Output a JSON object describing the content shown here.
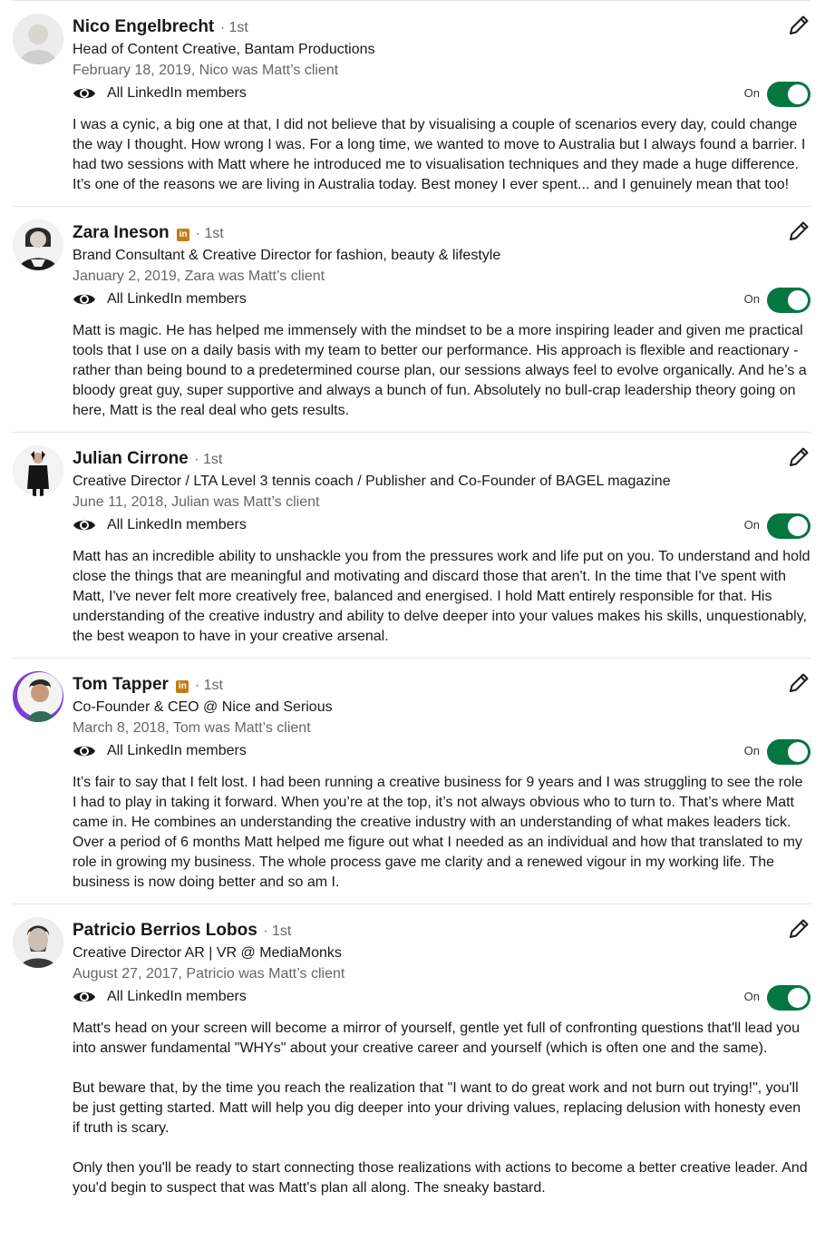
{
  "recommendations": [
    {
      "name": "Nico Engelbrecht",
      "badge": "",
      "degree": "· 1st",
      "headline": "Head of Content Creative, Bantam Productions",
      "date": "February 18, 2019, Nico was Matt’s client",
      "visibility": "All LinkedIn members",
      "toggle_label": "On",
      "text": "I was a cynic, a big one at that, I did not believe that by visualising a couple of scenarios every day, could change the way I thought. How wrong I was. For a long time, we wanted to move to Australia but I always found a barrier. I had two sessions with Matt where he introduced me to visualisation techniques and they made a huge difference. It’s one of the reasons we are living in Australia today. Best money I ever spent... and I genuinely mean that too!"
    },
    {
      "name": "Zara Ineson",
      "badge": "in",
      "degree": "· 1st",
      "headline": "Brand Consultant & Creative Director for fashion, beauty & lifestyle",
      "date": "January 2, 2019, Zara was Matt’s client",
      "visibility": "All LinkedIn members",
      "toggle_label": "On",
      "text": "Matt is magic. He has helped me immensely with the mindset to be a more inspiring leader and given me practical tools that I use on a daily basis with my team to better our performance. His approach is flexible and reactionary - rather than being bound to a predetermined course plan, our sessions always feel to evolve organically. And he’s a bloody great guy, super supportive and always a bunch of fun. Absolutely no bull-crap leadership theory going on here, Matt is the real deal who gets results."
    },
    {
      "name": "Julian Cirrone",
      "badge": "",
      "degree": "· 1st",
      "headline": "Creative Director / LTA Level 3 tennis coach / Publisher and Co-Founder of BAGEL magazine",
      "date": "June 11, 2018, Julian was Matt’s client",
      "visibility": "All LinkedIn members",
      "toggle_label": "On",
      "text": "Matt has an incredible ability to unshackle you from the pressures work and life put on you. To understand and hold close the things that are meaningful and motivating and discard those that aren't. In the time that I've spent with Matt, I've never felt more creatively free, balanced and energised. I hold Matt entirely responsible for that. His understanding of the creative industry and ability to delve deeper into your values makes his skills, unquestionably, the best weapon to have in your creative arsenal."
    },
    {
      "name": "Tom Tapper",
      "badge": "in",
      "degree": "· 1st",
      "headline": "Co-Founder & CEO @ Nice and Serious",
      "date": "March 8, 2018, Tom was Matt’s client",
      "visibility": "All LinkedIn members",
      "toggle_label": "On",
      "text": "It’s fair to say that I felt lost. I had been running a creative business for 9 years and I was struggling to see the role I had to play in taking it forward. When you’re at the top, it’s not always obvious who to turn to. That’s where Matt came in. He combines an understanding the creative industry with an understanding of what makes leaders tick. Over a period of 6 months Matt helped me figure out what I needed as an individual and how that translated to my role in growing my business. The whole process gave me clarity and a renewed vigour in my working life. The business is now doing better and so am I."
    },
    {
      "name": "Patricio Berrios Lobos",
      "badge": "",
      "degree": "· 1st",
      "headline": "Creative Director AR | VR @ MediaMonks",
      "date": "August 27, 2017, Patricio was Matt’s client",
      "visibility": "All LinkedIn members",
      "toggle_label": "On",
      "text": "Matt's head on your screen will become a mirror of yourself, gentle yet full of confronting questions that'll lead you into answer fundamental \"WHYs\" about your creative career and yourself (which is often one and the same).\n\nBut beware that, by the time you reach the realization that \"I want to do great work and not burn out trying!\", you'll be just getting started. Matt will help you dig deeper into your driving values, replacing delusion with honesty even if truth is scary.\n\nOnly then you'll be ready to start connecting those realizations with actions to become a better creative leader. And you'd begin to suspect that was Matt's plan all along. The sneaky bastard."
    }
  ]
}
